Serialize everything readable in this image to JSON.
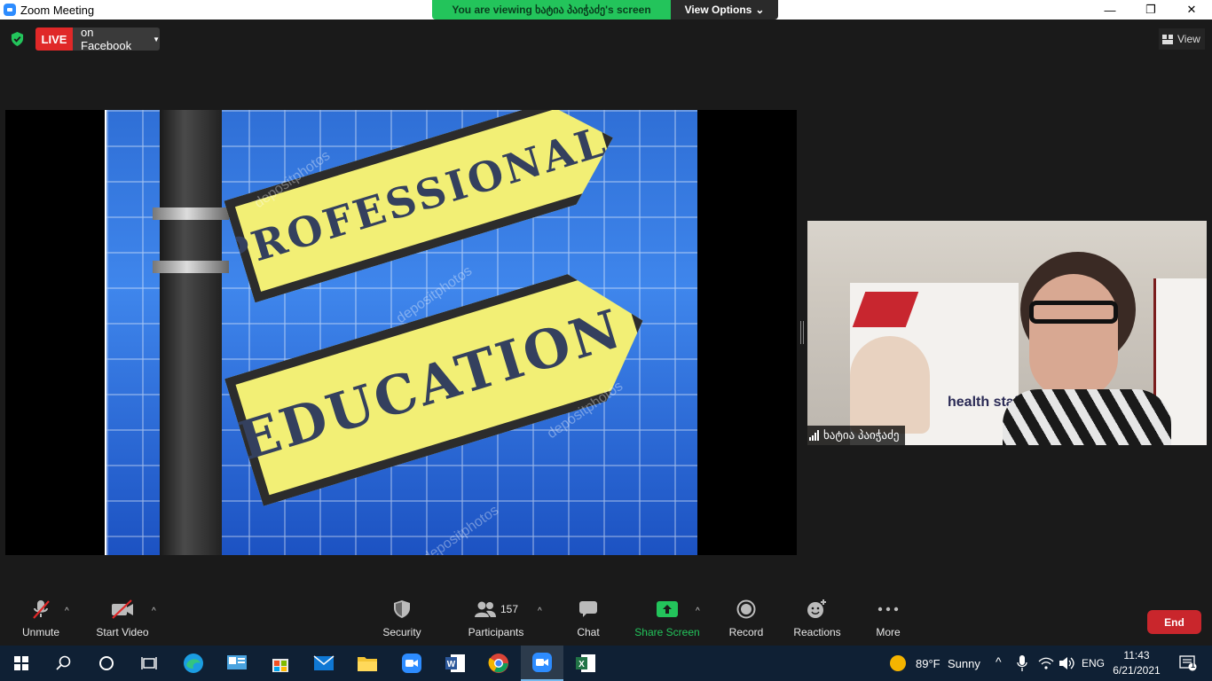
{
  "window": {
    "title": "Zoom Meeting",
    "minimize_glyph": "—",
    "restore_glyph": "❐",
    "close_glyph": "✕"
  },
  "banner": {
    "viewing_text": "You are viewing ხატია პაიჭაძე's screen",
    "view_options_label": "View Options"
  },
  "topbar": {
    "live_label": "LIVE",
    "live_destination": "on Facebook",
    "view_label": "View"
  },
  "shared_slide": {
    "sign_top_text": "PROFESSIONAL",
    "sign_bottom_text": "EDUCATION",
    "watermark": "depositphotos"
  },
  "participant_video": {
    "name": "ხატია პაიჭაძე",
    "background_text": "health staff"
  },
  "toolbar": {
    "unmute_label": "Unmute",
    "start_video_label": "Start Video",
    "security_label": "Security",
    "participants_label": "Participants",
    "participants_count": "157",
    "chat_label": "Chat",
    "share_screen_label": "Share Screen",
    "record_label": "Record",
    "reactions_label": "Reactions",
    "more_label": "More",
    "end_label": "End",
    "accent_share_color": "#23c45b",
    "end_color": "#c9262c"
  },
  "taskbar": {
    "weather_temp": "89°F",
    "weather_desc": "Sunny",
    "language": "ENG",
    "time": "11:43",
    "date": "6/21/2021",
    "notification_count": "1"
  }
}
